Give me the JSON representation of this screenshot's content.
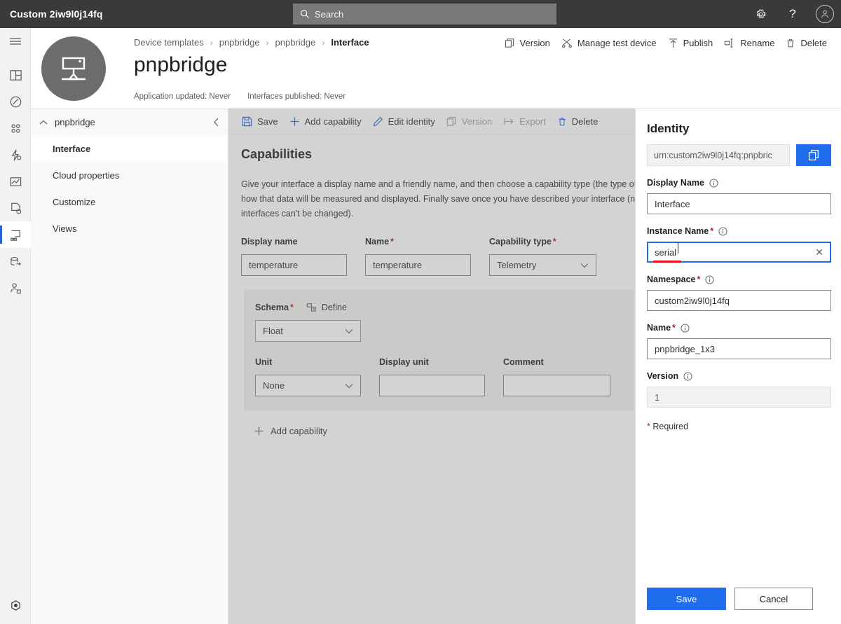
{
  "topbar": {
    "brand": "Custom 2iw9l0j14fq",
    "search_placeholder": "Search",
    "settings_icon": "gear-icon",
    "help_icon": "question-mark-icon",
    "account_icon": "person-icon"
  },
  "rail": {
    "items": [
      {
        "icon": "hamburger-menu-icon",
        "name": "menu-toggle"
      },
      {
        "icon": "dashboard-icon",
        "name": "dashboard"
      },
      {
        "icon": "analytics-icon",
        "name": "analytics"
      },
      {
        "icon": "devices-icon",
        "name": "devices"
      },
      {
        "icon": "device-groups-icon",
        "name": "device-groups"
      },
      {
        "icon": "rules-icon",
        "name": "rules"
      },
      {
        "icon": "jobs-icon",
        "name": "jobs"
      },
      {
        "icon": "device-templates-icon",
        "name": "device-templates",
        "selected": true
      },
      {
        "icon": "data-export-icon",
        "name": "data-export"
      },
      {
        "icon": "administration-icon",
        "name": "administration"
      }
    ],
    "bottom_icon": "app-preview-icon"
  },
  "header": {
    "breadcrumb": [
      {
        "label": "Device templates",
        "active": false
      },
      {
        "label": "pnpbridge",
        "active": false
      },
      {
        "label": "pnpbridge",
        "active": false
      },
      {
        "label": "Interface",
        "active": true
      }
    ],
    "breadcrumb_separator": "›",
    "title": "pnpbridge",
    "avatar_icon": "device-template-icon",
    "meta": [
      "Application updated: Never",
      "Interfaces published: Never"
    ],
    "commands": [
      {
        "label": "Version",
        "icon": "copy-pages-icon"
      },
      {
        "label": "Manage test device",
        "icon": "test-device-icon"
      },
      {
        "label": "Publish",
        "icon": "upload-arrow-icon"
      },
      {
        "label": "Rename",
        "icon": "rename-icon"
      },
      {
        "label": "Delete",
        "icon": "trash-icon"
      }
    ]
  },
  "sidenav": {
    "group_label": "pnpbridge",
    "expand_icon": "chevron-up-icon",
    "collapse_icon": "chevron-left-icon",
    "items": [
      {
        "label": "Interface",
        "selected": true
      },
      {
        "label": "Cloud properties",
        "selected": false
      },
      {
        "label": "Customize",
        "selected": false
      },
      {
        "label": "Views",
        "selected": false
      }
    ]
  },
  "main": {
    "toolbar": [
      {
        "label": "Save",
        "icon": "save-disk-icon",
        "disabled": false
      },
      {
        "label": "Add capability",
        "icon": "plus-icon",
        "disabled": false
      },
      {
        "label": "Edit identity",
        "icon": "pencil-icon",
        "disabled": false
      },
      {
        "label": "Version",
        "icon": "copy-pages-icon",
        "disabled": true
      },
      {
        "label": "Export",
        "icon": "export-arrow-icon",
        "disabled": true
      },
      {
        "label": "Delete",
        "icon": "trash-icon",
        "disabled": false
      }
    ],
    "section_title": "Capabilities",
    "description": "Give your interface a display name and a friendly name, and then choose a capability type (the type of data). Then choose how that data will be measured and displayed. Finally save once you have described your interface (note that standard interfaces can't be changed).",
    "capability": {
      "display_name_label": "Display name",
      "display_name_value": "temperature",
      "name_label": "Name",
      "name_required": "*",
      "name_value": "temperature",
      "capability_type_label": "Capability type",
      "capability_type_required": "*",
      "capability_type_value": "Telemetry",
      "schema_label": "Schema",
      "schema_required": "*",
      "define_label": "Define",
      "define_icon": "define-schema-icon",
      "schema_value": "Float",
      "unit_label": "Unit",
      "unit_value": "None",
      "display_unit_label": "Display unit",
      "display_unit_value": "",
      "comment_label": "Comment",
      "comment_value": ""
    },
    "add_capability_label": "Add capability",
    "add_capability_icon": "plus-icon"
  },
  "panel": {
    "title": "Identity",
    "urn_value": "urn:custom2iw9l0j14fq:pnpbric",
    "copy_icon": "copy-icon",
    "copy_color": "#1f6ced",
    "fields": [
      {
        "label": "Display Name",
        "required": "",
        "value": "Interface",
        "state": "normal",
        "info_icon": "info-icon"
      },
      {
        "label": "Instance Name",
        "required": "*",
        "value": "serial",
        "state": "focused",
        "clear_icon": "close-icon",
        "info_icon": "info-icon"
      },
      {
        "label": "Namespace",
        "required": "*",
        "value": "custom2iw9l0j14fq",
        "state": "normal",
        "info_icon": "info-icon"
      },
      {
        "label": "Name",
        "required": "*",
        "value": "pnpbridge_1x3",
        "state": "normal",
        "info_icon": "info-icon"
      },
      {
        "label": "Version",
        "required": "",
        "value": "1",
        "state": "readonly",
        "info_icon": "info-icon"
      }
    ],
    "required_star": "*",
    "required_note": " Required",
    "save_label": "Save",
    "cancel_label": "Cancel"
  }
}
